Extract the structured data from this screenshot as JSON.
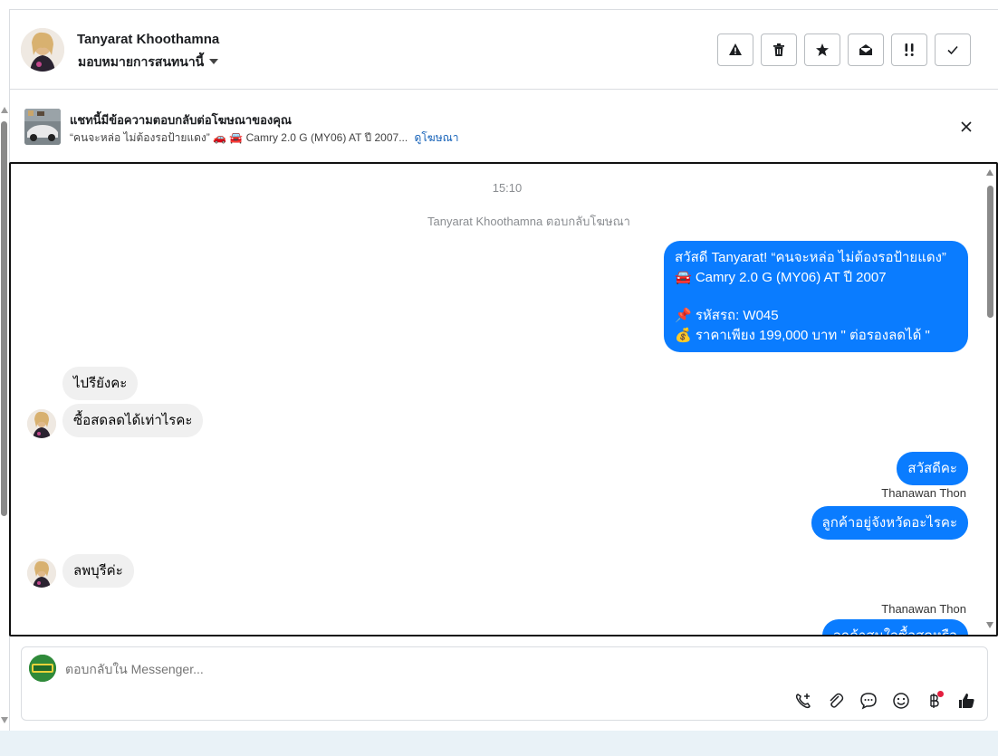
{
  "header": {
    "contact_name": "Tanyarat Khoothamna",
    "assign_label": "มอบหมายการสนทนานี้",
    "actions": [
      "spam-icon",
      "trash-icon",
      "star-icon",
      "mark-unread-icon",
      "follow-up-icon",
      "done-icon"
    ]
  },
  "ad_banner": {
    "title": "แชทนี้มีข้อความตอบกลับต่อโฆษณาของคุณ",
    "subtitle": "“คนจะหล่อ ไม่ต้องรอป้ายแดง” 🚗 🚘 Camry 2.0 G (MY06) AT ปี 2007...",
    "link": "ดูโฆษณา"
  },
  "chat": {
    "timestamp": "15:10",
    "system_note": "Tanyarat Khoothamna ตอบกลับโฆษณา",
    "ad_message": {
      "line1": "สวัสดี Tanyarat! “คนจะหล่อ ไม่ต้องรอป้ายแดง”",
      "line2": "🚘 Camry 2.0 G (MY06) AT ปี 2007",
      "line3": "📌 รหัสรถ: W045",
      "line4": "💰 ราคาเพียง 199,000 บาท \" ต่อรองลดได้ \""
    },
    "incoming_1": "ไปรียังคะ",
    "incoming_2": "ซื้อสดลดได้เท่าไรคะ",
    "outgoing_1": "สวัสดีคะ",
    "sender_1": "Thanawan Thon",
    "outgoing_2": "ลูกค้าอยู่จังหวัดอะไรคะ",
    "incoming_3": "ลพบุรีค่ะ",
    "sender_2": "Thanawan Thon",
    "outgoing_3_partial": "ลูกค้าสนใจซื้อสดหรือ"
  },
  "composer": {
    "placeholder": "ตอบกลับใน Messenger...",
    "tools": [
      "call-add-icon",
      "attach-icon",
      "saved-replies-icon",
      "emoji-icon",
      "baht-icon",
      "thumbs-up-icon"
    ]
  },
  "colors": {
    "outgoing_bubble": "#0a7cff",
    "incoming_bubble": "#f0f0f0",
    "link": "#1461b8"
  }
}
